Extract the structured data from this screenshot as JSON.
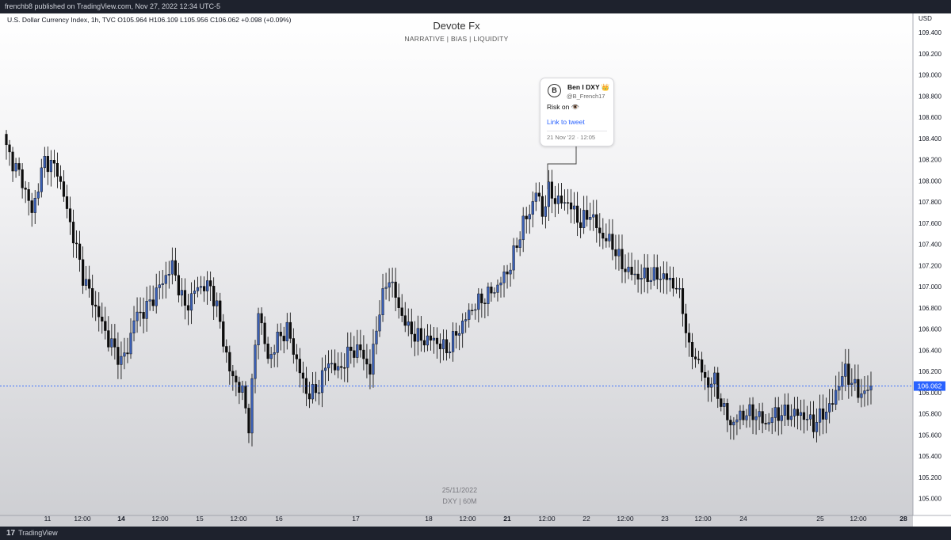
{
  "topbar": {
    "text": "frenchb8 published on TradingView.com, Nov 27, 2022 12:34 UTC-5"
  },
  "legend": {
    "text": "U.S. Dollar Currency Index, 1h, TVC  O105.964  H106.109  L105.956  C106.062  +0.098 (+0.09%)"
  },
  "title": "Devote Fx",
  "subtitle": "NARRATIVE   |  BIAS  |  LIQUIDITY",
  "watermark": {
    "date": "25/11/2022",
    "symbol": "DXY | 60M"
  },
  "currency": "USD",
  "footer": {
    "logo": "17",
    "brand": "TradingView"
  },
  "tweet": {
    "avatar": "B",
    "name": "Ben I DXY 👑",
    "handle": "@B_French17",
    "text": "Risk on 👁️",
    "link": "Link to tweet",
    "date": "21 Nov '22 · 12:05"
  },
  "colors": {
    "up": "#3a5fb4",
    "down": "#0d0d0d",
    "price_line": "#2962ff",
    "price_label": "#2962ff"
  },
  "chart_data": {
    "type": "candlestick",
    "symbol": "DXY",
    "timeframe": "1h",
    "ylim": [
      104.9,
      109.52
    ],
    "y_ticks": [
      "109.400",
      "109.200",
      "109.000",
      "108.800",
      "108.600",
      "108.400",
      "108.200",
      "108.000",
      "107.800",
      "107.600",
      "107.400",
      "107.200",
      "107.000",
      "106.800",
      "106.600",
      "106.400",
      "106.200",
      "106.000",
      "105.800",
      "105.600",
      "105.400",
      "105.200",
      "105.000"
    ],
    "x_ticks": [
      "11",
      "12:00",
      "14",
      "12:00",
      "15",
      "12:00",
      "16",
      "17",
      "18",
      "12:00",
      "21",
      "12:00",
      "22",
      "12:00",
      "23",
      "12:00",
      "24",
      "25",
      "12:00",
      "28"
    ],
    "x_ticks_bold": [
      "14",
      "21",
      "28"
    ],
    "last_price": "106.062",
    "last": 106.062,
    "anchors": [
      [
        0,
        108.3
      ],
      [
        5,
        108.0
      ],
      [
        8,
        107.7
      ],
      [
        12,
        108.2
      ],
      [
        16,
        108.1
      ],
      [
        20,
        107.6
      ],
      [
        24,
        107.1
      ],
      [
        28,
        106.8
      ],
      [
        32,
        106.5
      ],
      [
        36,
        106.3
      ],
      [
        38,
        106.4
      ],
      [
        40,
        106.7
      ],
      [
        44,
        106.8
      ],
      [
        48,
        107.0
      ],
      [
        52,
        107.2
      ],
      [
        56,
        106.8
      ],
      [
        60,
        107.0
      ],
      [
        64,
        107.0
      ],
      [
        66,
        106.8
      ],
      [
        70,
        106.2
      ],
      [
        74,
        106.0
      ],
      [
        76,
        105.7
      ],
      [
        79,
        106.8
      ],
      [
        82,
        106.3
      ],
      [
        85,
        106.5
      ],
      [
        88,
        106.6
      ],
      [
        91,
        106.3
      ],
      [
        94,
        106.0
      ],
      [
        97,
        106.0
      ],
      [
        101,
        106.3
      ],
      [
        104,
        106.2
      ],
      [
        108,
        106.4
      ],
      [
        111,
        106.4
      ],
      [
        114,
        106.2
      ],
      [
        117,
        106.8
      ],
      [
        120,
        107.1
      ],
      [
        123,
        106.8
      ],
      [
        126,
        106.6
      ],
      [
        130,
        106.5
      ],
      [
        134,
        106.5
      ],
      [
        138,
        106.4
      ],
      [
        142,
        106.6
      ],
      [
        146,
        106.8
      ],
      [
        150,
        106.9
      ],
      [
        154,
        107.0
      ],
      [
        158,
        107.2
      ],
      [
        162,
        107.6
      ],
      [
        164,
        107.7
      ],
      [
        166,
        107.9
      ],
      [
        168,
        107.7
      ],
      [
        170,
        107.9
      ],
      [
        173,
        107.8
      ],
      [
        176,
        107.8
      ],
      [
        180,
        107.6
      ],
      [
        183,
        107.7
      ],
      [
        186,
        107.5
      ],
      [
        190,
        107.4
      ],
      [
        193,
        107.2
      ],
      [
        197,
        107.1
      ],
      [
        201,
        107.1
      ],
      [
        206,
        107.1
      ],
      [
        210,
        107.0
      ],
      [
        212,
        106.8
      ],
      [
        214,
        106.4
      ],
      [
        217,
        106.3
      ],
      [
        219,
        106.1
      ],
      [
        222,
        106.1
      ],
      [
        224,
        105.9
      ],
      [
        227,
        105.7
      ],
      [
        231,
        105.8
      ],
      [
        235,
        105.8
      ],
      [
        238,
        105.7
      ],
      [
        241,
        105.8
      ],
      [
        245,
        105.8
      ],
      [
        249,
        105.8
      ],
      [
        253,
        105.7
      ],
      [
        256,
        105.8
      ],
      [
        259,
        105.9
      ],
      [
        261,
        106.1
      ],
      [
        263,
        106.2
      ],
      [
        265,
        106.1
      ],
      [
        267,
        106.0
      ],
      [
        269,
        106.0
      ],
      [
        271,
        106.06
      ]
    ]
  }
}
